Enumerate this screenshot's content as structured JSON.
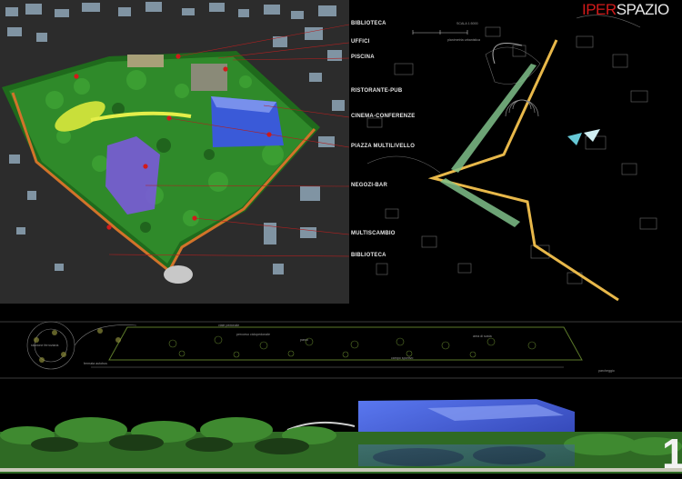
{
  "brand": {
    "part1": "IPER",
    "part2": "SPAZIO",
    "color_part1": "#d31a1a",
    "color_part2": "#e9e9e9"
  },
  "function_labels": [
    "BIBLIOTECA",
    "UFFICI",
    "PISCINA",
    "RISTORANTE-PUB",
    "CINEMA-CONFERENZE",
    "PIAZZA MULTILIVELLO",
    "NEGOZI-BAR",
    "MULTISCAMBIO",
    "BIBLIOTECA"
  ],
  "map": {
    "scale_top": "SCALA 1:5000",
    "caption_top": "planimetria urbanistica",
    "scale_bottom": "SCALA 1:500",
    "caption_bottom": "stralcio degli alzati"
  },
  "plan": {
    "annotations": [
      "stazione ferroviaria",
      "viale pedonale",
      "parco",
      "percorso ciclopedonale",
      "fermata autobus",
      "campo sportivo",
      "parcheggio",
      "area di sosta"
    ]
  },
  "sheet": {
    "number": "1"
  },
  "colors": {
    "accent_red": "#d31a1a",
    "leader_line": "#b02020",
    "path_yellow": "#e8b84a",
    "glass_blue": "#3a5ad8",
    "vegetation": "#2f8a2a",
    "plan_green": "#5c7a2a"
  }
}
